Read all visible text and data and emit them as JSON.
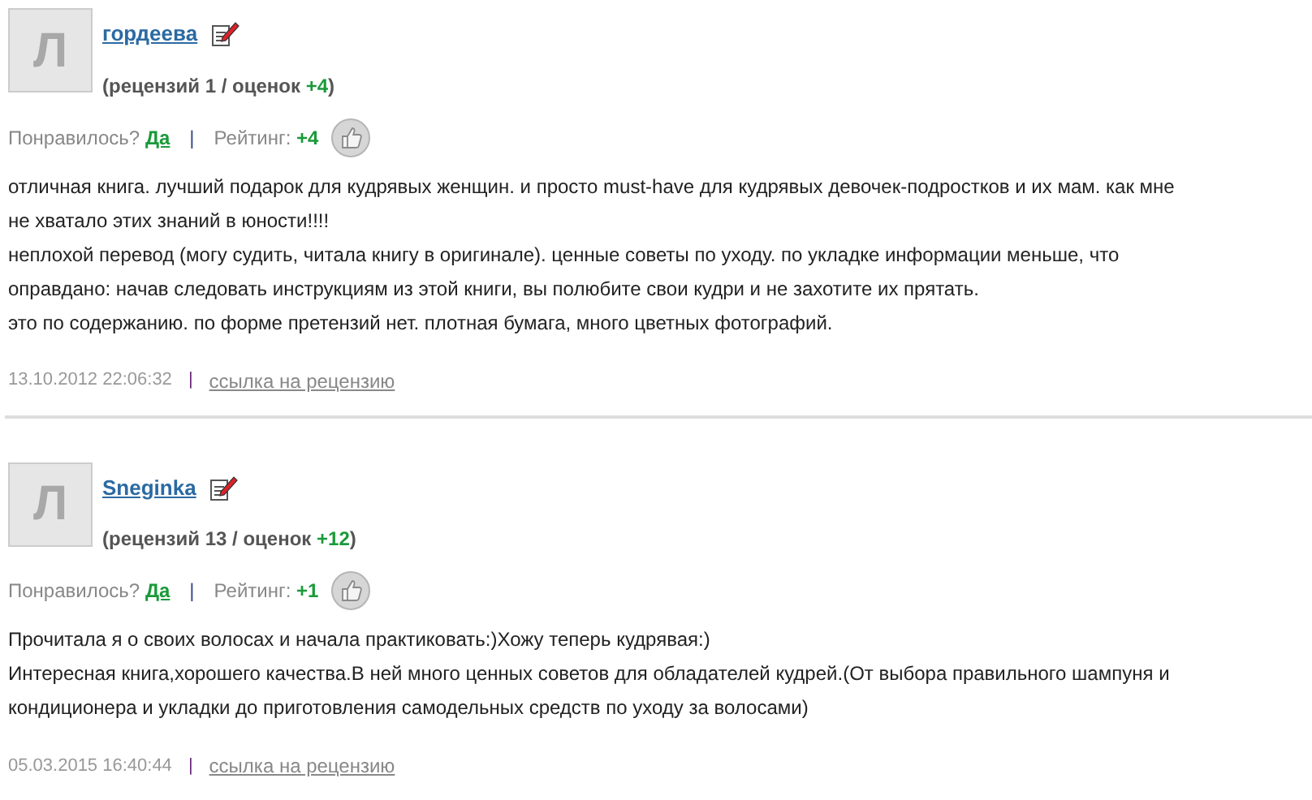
{
  "reviews": [
    {
      "avatar_letter": "Л",
      "author": "гордеева",
      "stats": "(рецензий 1 / оценок",
      "stats_score": "+4",
      "stats_close": ")",
      "liked_label": "Понравилось?",
      "liked_link": "Да",
      "separator": "|",
      "rating_label": "Рейтинг:",
      "rating": "+4",
      "paragraphs": [
        "отличная книга. лучший подарок для кудрявых женщин. и просто must-have для кудрявых девочек-подростков и их мам. как мне не хватало этих знаний в юности!!!!",
        "неплохой перевод (могу судить, читала книгу в оригинале). ценные советы по уходу. по укладке информации меньше, что оправдано: начав следовать инструкциям из этой книги, вы полюбите свои кудри и не захотите их прятать.",
        "это по содержанию. по форме претензий нет. плотная бумага, много цветных фотографий."
      ],
      "date": "13.10.2012 22:06:32",
      "date_separator": "|",
      "link": "ссылка на рецензию"
    },
    {
      "avatar_letter": "Л",
      "author": "Sneginka",
      "stats": "(рецензий 13 / оценок",
      "stats_score": "+12",
      "stats_close": ")",
      "liked_label": "Понравилось?",
      "liked_link": "Да",
      "separator": "|",
      "rating_label": "Рейтинг:",
      "rating": "+1",
      "paragraphs": [
        "Прочитала я о своих волосах и начала практиковать:)Хожу теперь кудрявая:)",
        "Интересная книга,хорошего качества.В ней много ценных советов для обладателей кудрей.(От выбора правильного шампуня и кондиционера и укладки до приготовления самодельных средств по уходу за волосами)"
      ],
      "date": "05.03.2015 16:40:44",
      "date_separator": "|",
      "link": "ссылка на рецензию"
    }
  ]
}
